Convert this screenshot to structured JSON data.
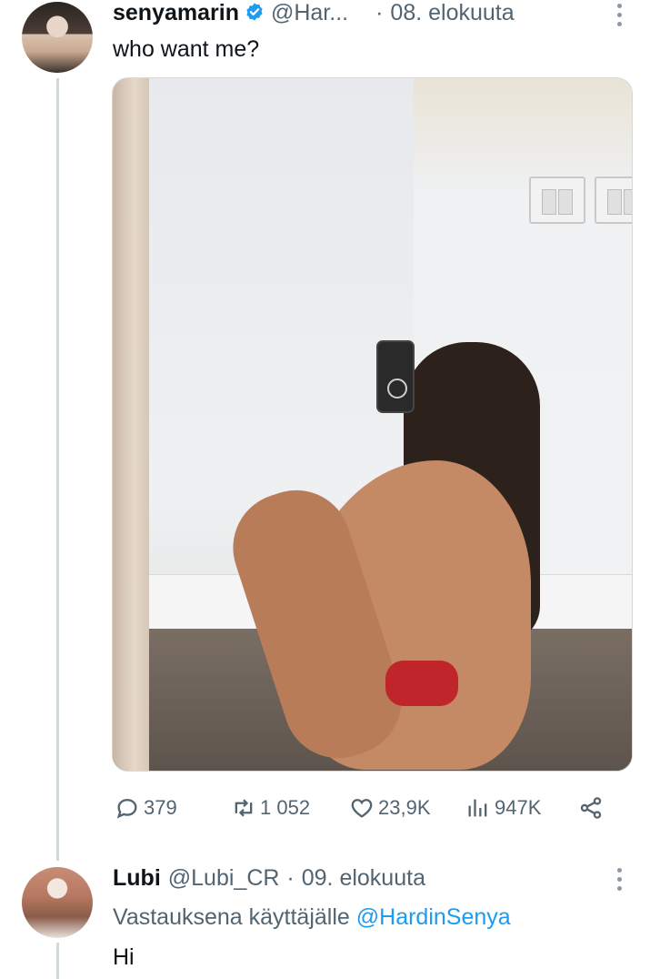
{
  "tweet": {
    "author_name": "senyamarin",
    "verified": true,
    "handle": "@Har...",
    "separator": "·",
    "date": "08. elokuuta",
    "text": "who want me?",
    "metrics": {
      "replies": "379",
      "retweets": "1 052",
      "likes": "23,9K",
      "views": "947K"
    }
  },
  "reply": {
    "author_name": "Lubi",
    "handle": "@Lubi_CR",
    "separator": "·",
    "date": "09. elokuuta",
    "replying_prefix": "Vastauksena käyttäjälle",
    "replying_to": "@HardinSenya",
    "text": "Hi"
  },
  "colors": {
    "text_primary": "#0f1419",
    "text_secondary": "#536471",
    "accent": "#1d9bf0",
    "thread_line": "#cfd9de"
  },
  "icons": {
    "verified": "verified-badge-icon",
    "more": "more-vertical-icon",
    "reply": "reply-icon",
    "retweet": "retweet-icon",
    "like": "heart-icon",
    "views": "views-icon",
    "share": "share-icon"
  }
}
